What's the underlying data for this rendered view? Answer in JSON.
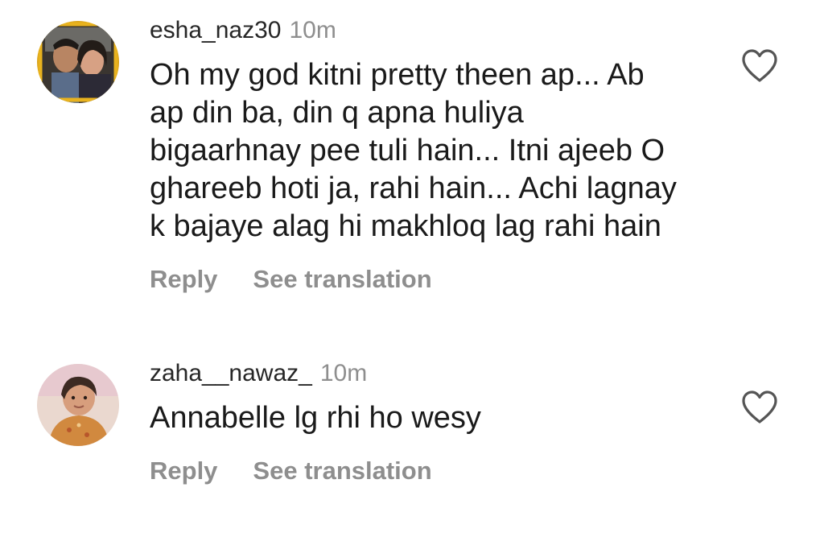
{
  "comments": [
    {
      "username": "esha_naz30",
      "time": "10m",
      "text_lines": [
        "Oh my god kitni pretty theen ap... Ab",
        "ap din ba, din q apna huliya",
        "bigaarhnay pee tuli hain... Itni ajeeb O",
        "ghareeb hoti ja, rahi hain... Achi lagnay",
        "k bajaye alag hi makhloq lag rahi hain"
      ],
      "reply_label": "Reply",
      "translate_label": "See translation",
      "like_icon": "heart-outline-icon"
    },
    {
      "username": "zaha__nawaz_",
      "time": "10m",
      "text_lines": [
        "Annabelle lg rhi ho wesy"
      ],
      "reply_label": "Reply",
      "translate_label": "See translation",
      "like_icon": "heart-outline-icon"
    }
  ],
  "colors": {
    "primary_text": "#1a1a1a",
    "secondary_text": "#8e8e8e",
    "background": "#ffffff"
  }
}
